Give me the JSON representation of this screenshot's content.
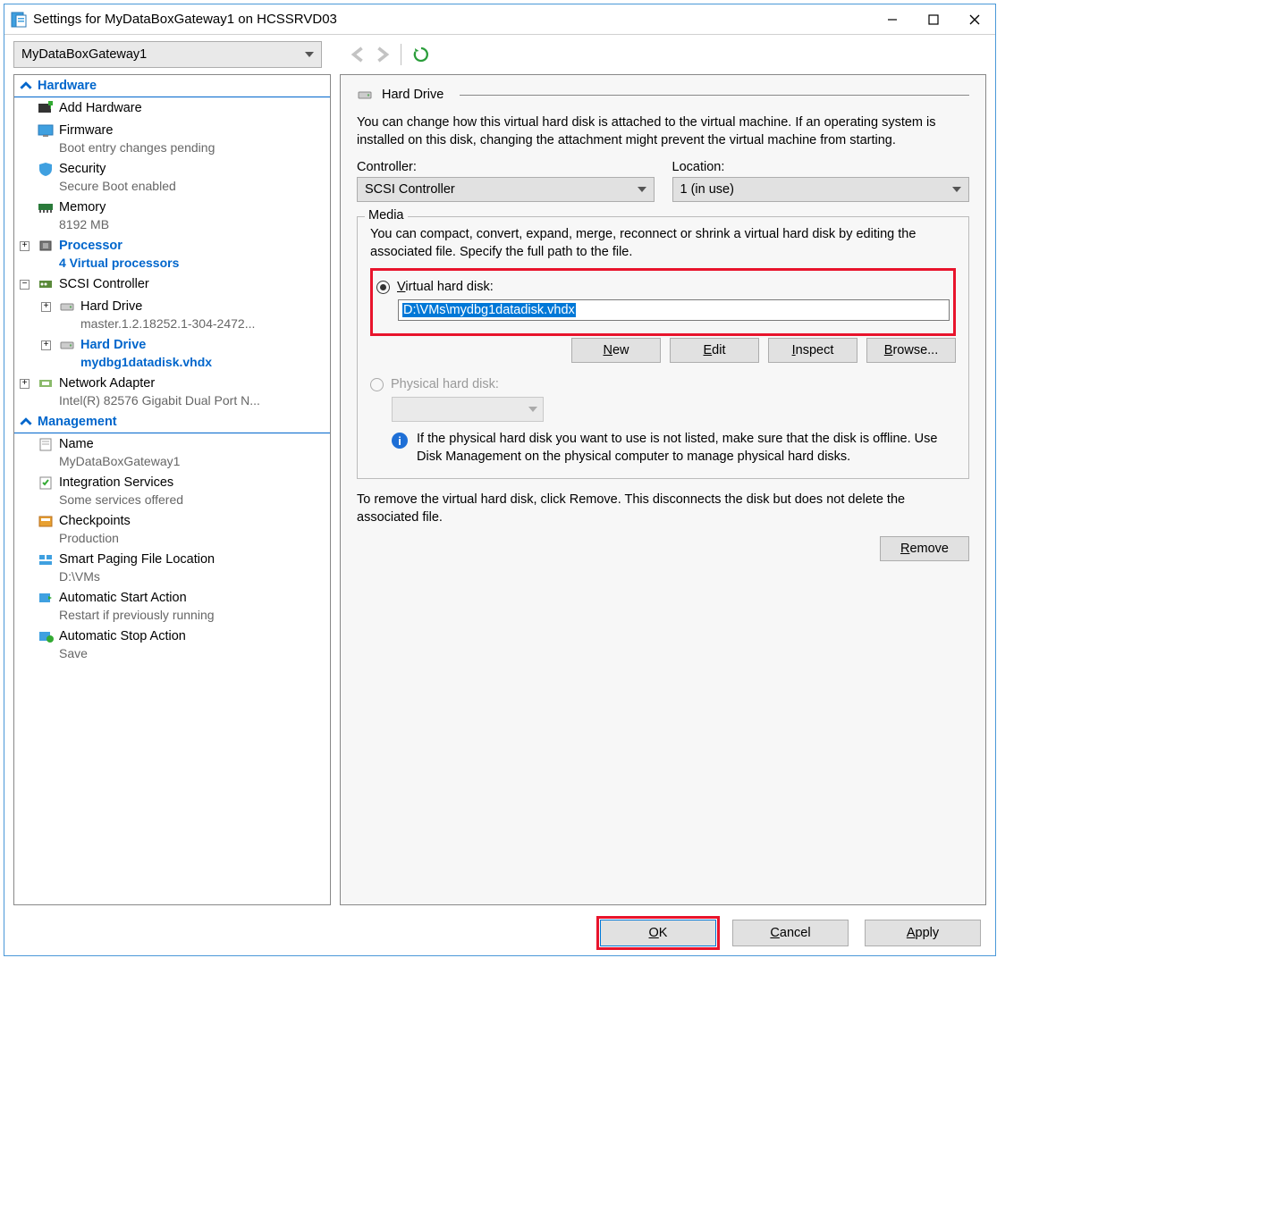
{
  "window": {
    "title": "Settings for MyDataBoxGateway1 on HCSSRVD03"
  },
  "toolbar": {
    "vm_selected": "MyDataBoxGateway1"
  },
  "tree": {
    "hardware_header": "Hardware",
    "management_header": "Management",
    "add_hardware": "Add Hardware",
    "firmware": {
      "label": "Firmware",
      "sub": "Boot entry changes pending"
    },
    "security": {
      "label": "Security",
      "sub": "Secure Boot enabled"
    },
    "memory": {
      "label": "Memory",
      "sub": "8192 MB"
    },
    "processor": {
      "label": "Processor",
      "sub": "4 Virtual processors"
    },
    "scsi": {
      "label": "SCSI Controller"
    },
    "hd1": {
      "label": "Hard Drive",
      "sub": "master.1.2.18252.1-304-2472..."
    },
    "hd2": {
      "label": "Hard Drive",
      "sub": "mydbg1datadisk.vhdx"
    },
    "net": {
      "label": "Network Adapter",
      "sub": "Intel(R) 82576 Gigabit Dual Port N..."
    },
    "name": {
      "label": "Name",
      "sub": "MyDataBoxGateway1"
    },
    "integ": {
      "label": "Integration Services",
      "sub": "Some services offered"
    },
    "chk": {
      "label": "Checkpoints",
      "sub": "Production"
    },
    "paging": {
      "label": "Smart Paging File Location",
      "sub": "D:\\VMs"
    },
    "autostart": {
      "label": "Automatic Start Action",
      "sub": "Restart if previously running"
    },
    "autostop": {
      "label": "Automatic Stop Action",
      "sub": "Save"
    }
  },
  "pane": {
    "title": "Hard Drive",
    "desc": "You can change how this virtual hard disk is attached to the virtual machine. If an operating system is installed on this disk, changing the attachment might prevent the virtual machine from starting.",
    "controller_label": "Controller:",
    "controller_value": "SCSI Controller",
    "location_label": "Location:",
    "location_value": "1 (in use)",
    "media_legend": "Media",
    "media_desc": "You can compact, convert, expand, merge, reconnect or shrink a virtual hard disk by editing the associated file. Specify the full path to the file.",
    "vhd_radio": "Virtual hard disk:",
    "vhd_path": "D:\\VMs\\mydbg1datadisk.vhdx",
    "btn_new": "New",
    "btn_edit": "Edit",
    "btn_inspect": "Inspect",
    "btn_browse": "Browse...",
    "phys_radio": "Physical hard disk:",
    "phys_info": "If the physical hard disk you want to use is not listed, make sure that the disk is offline. Use Disk Management on the physical computer to manage physical hard disks.",
    "remove_desc": "To remove the virtual hard disk, click Remove. This disconnects the disk but does not delete the associated file.",
    "btn_remove": "Remove"
  },
  "footer": {
    "ok": "OK",
    "cancel": "Cancel",
    "apply": "Apply"
  }
}
